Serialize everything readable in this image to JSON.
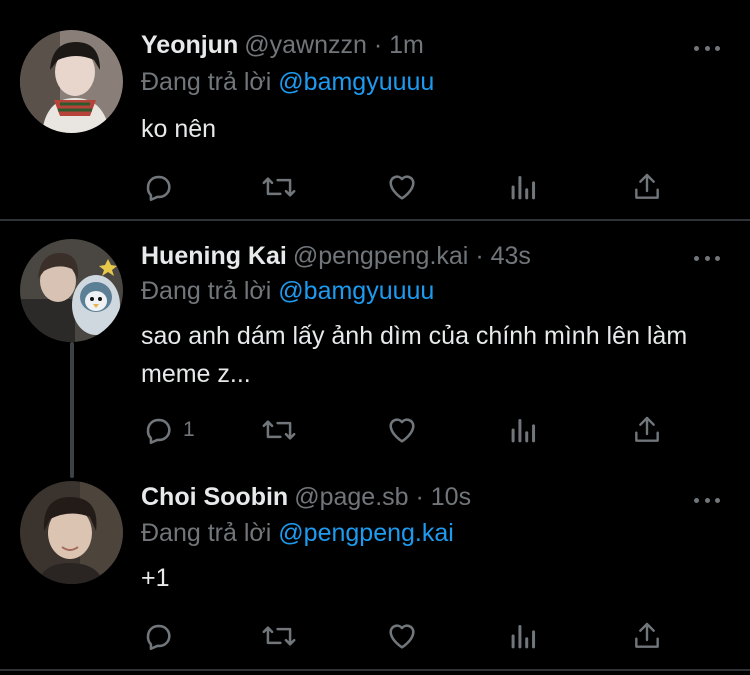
{
  "tweets": [
    {
      "display_name": "Yeonjun",
      "handle": "@yawnzzn",
      "time": "1m",
      "reply_prefix": "Đang trả lời",
      "reply_to": "@bamgyuuuu",
      "text": "ko nên",
      "reply_count": "",
      "avatar_icon": "person-photo-icon"
    },
    {
      "display_name": "Huening Kai",
      "handle": "@pengpeng.kai",
      "time": "43s",
      "reply_prefix": "Đang trả lời",
      "reply_to": "@bamgyuuuu",
      "text": "sao anh dám lấy ảnh dìm của chính mình lên làm meme z...",
      "reply_count": "1",
      "avatar_icon": "person-photo-icon"
    },
    {
      "display_name": "Choi Soobin",
      "handle": "@page.sb",
      "time": "10s",
      "reply_prefix": "Đang trả lời",
      "reply_to": "@pengpeng.kai",
      "text": "+1",
      "reply_count": "",
      "avatar_icon": "person-photo-icon"
    }
  ],
  "separator": "·",
  "colors": {
    "background": "#000000",
    "text": "#e7e9ea",
    "muted": "#71767b",
    "mention": "#1d9bf0",
    "divider": "#2f3336"
  },
  "action_icons": [
    "reply-icon",
    "retweet-icon",
    "like-icon",
    "analytics-icon",
    "share-icon"
  ]
}
